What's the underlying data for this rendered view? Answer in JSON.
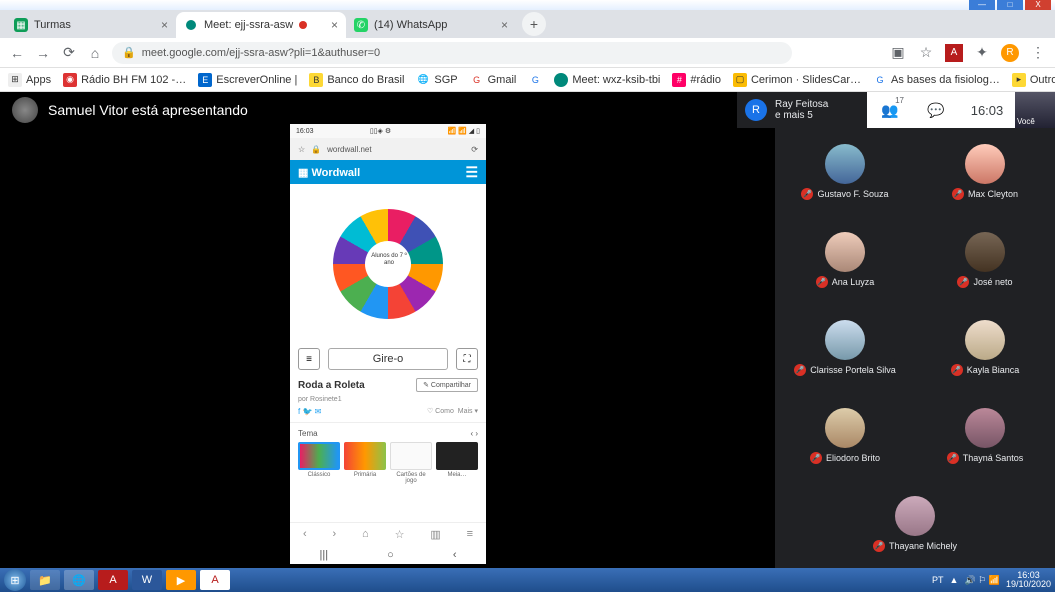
{
  "window": {
    "min": "—",
    "max": "□",
    "close": "X"
  },
  "tabs": [
    {
      "label": "Turmas",
      "fav": "▦"
    },
    {
      "label": "Meet: ejj-ssra-asw",
      "fav": "●"
    },
    {
      "label": "(14) WhatsApp",
      "fav": "✆"
    }
  ],
  "newtab": "+",
  "nav": {
    "back": "←",
    "fwd": "→",
    "reload": "⟳",
    "home": "⌂"
  },
  "url": {
    "lock": "🔒",
    "text": "meet.google.com/ejj-ssra-asw?pli=1&authuser=0"
  },
  "urlright": {
    "cast": "▣",
    "star": "☆",
    "pdf": "A",
    "puzzle": "✦",
    "avatar": "R"
  },
  "bookmarks": {
    "apps": "Apps",
    "items": [
      "Rádio BH FM 102 -…",
      "EscreverOnline |",
      "Banco do Brasil",
      "SGP",
      "Gmail",
      "Meet: wxz-ksib-tbi",
      "#rádio",
      "Cerimon · SlidesCar…",
      "As bases da fisiolog…"
    ],
    "other": "Outros favoritos"
  },
  "meet": {
    "presenting": "Samuel Vitor está apresentando",
    "pin": {
      "initial": "R",
      "line1": "Ray Feitosa",
      "line2": "e mais 5"
    },
    "people_count": "17",
    "clock": "16:03",
    "you": "Você"
  },
  "phone": {
    "status_time": "16:03",
    "status_icons": "▯▯◈ ⚙",
    "status_right": "📶 📶 ◢ ▯",
    "url_lock": "🔒",
    "url": "wordwall.net",
    "url_star": "☆",
    "url_reload": "⟳",
    "brand": "▦ Wordwall",
    "hamburger": "☰",
    "wheel_center": "Alunos do 7 º ano",
    "menu_icon": "≡",
    "spin": "Gire-o",
    "full_icon": "⛶",
    "title": "Roda a Roleta",
    "share": "✎ Compartilhar",
    "author": "por Rosinete1",
    "social": "f 🐦 ✉",
    "like": "♡ Como",
    "more": "Mais ▾",
    "tema": "Tema",
    "tema_nav": "‹  ›",
    "themes": [
      "Clássico",
      "Primária",
      "Cartões de jogo",
      "Meia…"
    ],
    "nav_top": [
      "‹",
      "›",
      "⌂",
      "☆",
      "▥",
      "≡"
    ],
    "nav_bot": [
      "|||",
      "○",
      "‹"
    ]
  },
  "participants": [
    "Gustavo F. Souza",
    "Max Cleyton",
    "Ana Luyza",
    "José neto",
    "Clarisse Portela Silva",
    "Kayla Bianca",
    "Eliodoro Brito",
    "Thayná Santos",
    "Thayane Michely"
  ],
  "mic_icon": "🎤",
  "taskbar": {
    "start": "⊞",
    "apps": [
      "📁",
      "🌐",
      "A",
      "W",
      "▶",
      "A"
    ],
    "tray_lang": "PT",
    "tray_up": "▲",
    "tray_icons": "🔊 ⚐ 📶",
    "tray_time": "16:03",
    "tray_date": "19/10/2020"
  }
}
